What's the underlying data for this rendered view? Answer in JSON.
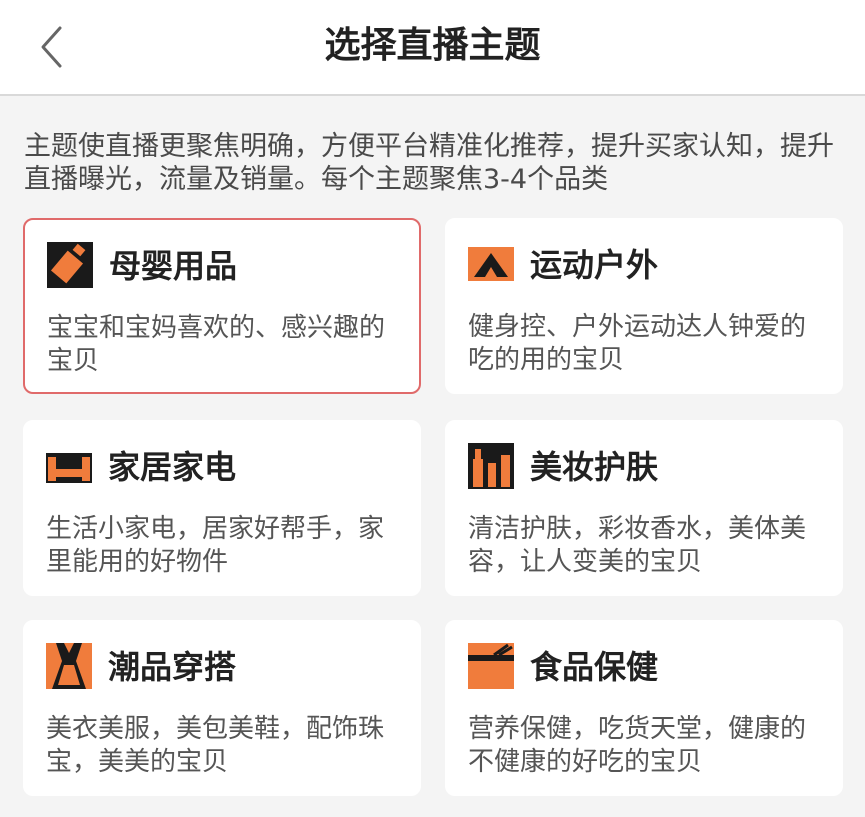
{
  "header": {
    "title": "选择直播主题"
  },
  "intro": "主题使直播更聚焦明确，方便平台精准化推荐，提升买家认知，提升直播曝光，流量及销量。每个主题聚焦3-4个品类",
  "accent_color": "#f07c3c",
  "selected_border_color": "#e06a6a",
  "themes": [
    {
      "title": "母婴用品",
      "desc": "宝宝和宝妈喜欢的、感兴趣的宝贝",
      "icon": "baby-bottle-icon",
      "selected": true
    },
    {
      "title": "运动户外",
      "desc": "健身控、户外运动达人钟爱的吃的用的宝贝",
      "icon": "tent-icon",
      "selected": false
    },
    {
      "title": "家居家电",
      "desc": "生活小家电，居家好帮手，家里能用的好物件",
      "icon": "sofa-icon",
      "selected": false
    },
    {
      "title": "美妆护肤",
      "desc": "清洁护肤，彩妆香水，美体美容，让人变美的宝贝",
      "icon": "cosmetics-icon",
      "selected": false
    },
    {
      "title": "潮品穿搭",
      "desc": "美衣美服，美包美鞋，配饰珠宝，美美的宝贝",
      "icon": "dress-icon",
      "selected": false
    },
    {
      "title": "食品保健",
      "desc": "营养保健，吃货天堂，健康的不健康的好吃的宝贝",
      "icon": "food-bowl-icon",
      "selected": false
    }
  ]
}
